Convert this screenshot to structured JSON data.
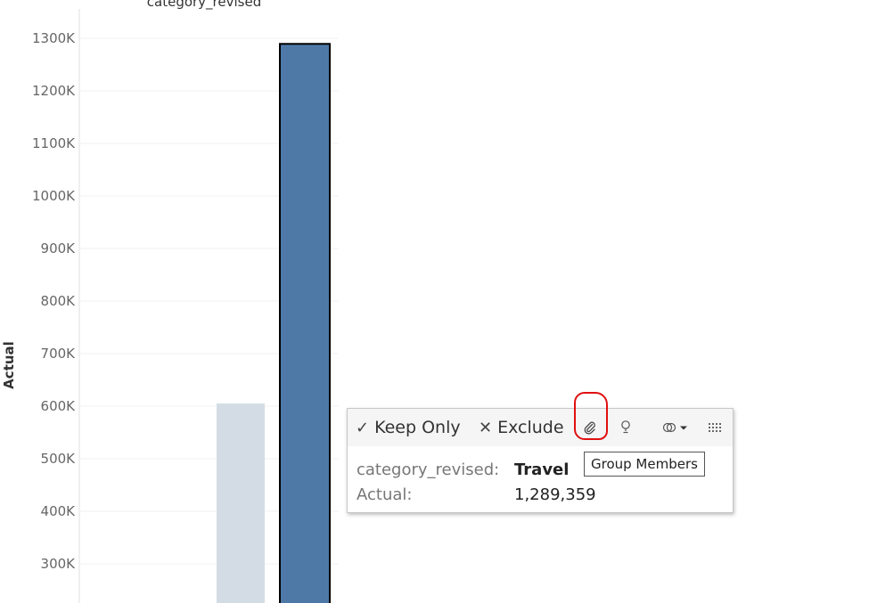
{
  "header": {
    "title": "category_revised"
  },
  "chart_data": {
    "type": "bar",
    "ylabel": "Actual",
    "y_ticks": [
      "300K",
      "400K",
      "500K",
      "600K",
      "700K",
      "800K",
      "900K",
      "1000K",
      "1100K",
      "1200K",
      "1300K"
    ],
    "y_tick_values": [
      300000,
      400000,
      500000,
      600000,
      700000,
      800000,
      900000,
      1000000,
      1100000,
      1200000,
      1300000
    ],
    "categories": [
      "",
      "Travel"
    ],
    "values": [
      605000,
      1289359
    ],
    "selected_category": "Travel",
    "colors": {
      "bar_dimmed": "#d3dce4",
      "bar_selected": "#4e79a7",
      "selected_outline": "#000000",
      "grid": "#f0f0f0"
    }
  },
  "tooltip": {
    "keep_only": {
      "glyph": "✓",
      "label": "Keep Only"
    },
    "exclude": {
      "glyph": "✕",
      "label": "Exclude"
    },
    "icons": {
      "group": "paperclip-icon",
      "highlight": "lightbulb-icon",
      "sets": "sets-icon",
      "view_data": "view-data-icon"
    },
    "rows": [
      {
        "key": "category_revised:",
        "value": "Travel"
      },
      {
        "key": "Actual:",
        "value": "1,289,359"
      }
    ],
    "hover_tip": "Group Members"
  },
  "annotation": {
    "color": "#e01010"
  }
}
